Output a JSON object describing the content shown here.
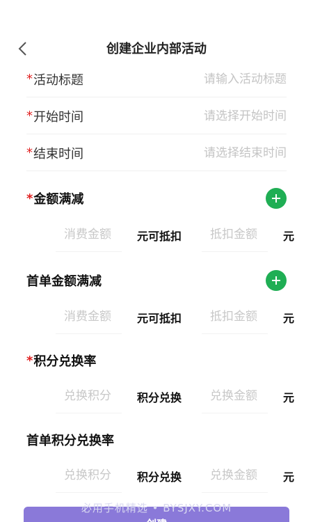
{
  "header": {
    "title": "创建企业内部活动",
    "back_icon": "chevron-left-icon"
  },
  "required_mark": "*",
  "form": {
    "title_label": "活动标题",
    "title_placeholder": "请输入活动标题",
    "start_label": "开始时间",
    "start_placeholder": "请选择开始时间",
    "end_label": "结束时间",
    "end_placeholder": "请选择结束时间"
  },
  "sections": {
    "amount_reduction": {
      "title": "金额满减",
      "required": true,
      "spend_placeholder": "消费金额",
      "middle_text": "元可抵扣",
      "deduct_placeholder": "抵扣金额",
      "unit": "元"
    },
    "first_order_amount_reduction": {
      "title": "首单金额满减",
      "required": false,
      "spend_placeholder": "消费金额",
      "middle_text": "元可抵扣",
      "deduct_placeholder": "抵扣金额",
      "unit": "元"
    },
    "points_exchange": {
      "title": "积分兑换率",
      "required": true,
      "points_placeholder": "兑换积分",
      "middle_text": "积分兑换",
      "amount_placeholder": "兑换金额",
      "unit": "元"
    },
    "first_order_points_exchange": {
      "title": "首单积分兑换率",
      "required": false,
      "points_placeholder": "兑换积分",
      "middle_text": "积分兑换",
      "amount_placeholder": "兑换金额",
      "unit": "元"
    }
  },
  "submit_label": "创建",
  "watermark": "必用手机精选 • BYSJXY.COM",
  "colors": {
    "accent_green": "#1fae54",
    "required_red": "#e02020",
    "button_purple": "#8a79d9",
    "placeholder_gray": "#c4c4c4"
  }
}
